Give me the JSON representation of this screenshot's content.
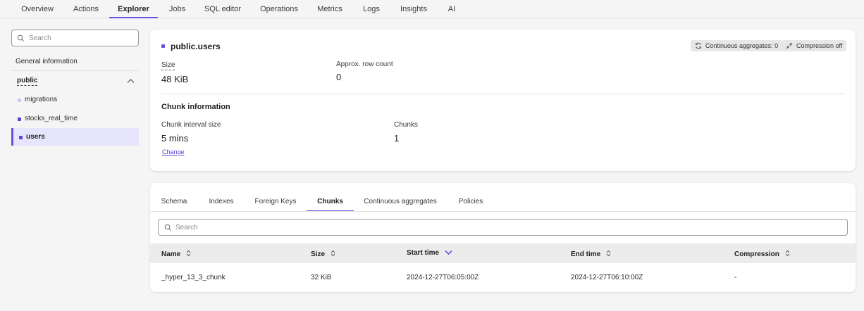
{
  "nav": {
    "tabs": [
      "Overview",
      "Actions",
      "Explorer",
      "Jobs",
      "SQL editor",
      "Operations",
      "Metrics",
      "Logs",
      "Insights",
      "AI"
    ],
    "active": "Explorer"
  },
  "sidebar": {
    "search_placeholder": "Search",
    "general_info": "General information",
    "schema": "public",
    "items": [
      {
        "label": "migrations",
        "color": "#c6c9f2"
      },
      {
        "label": "stocks_real_time",
        "color": "#5b3fd6"
      },
      {
        "label": "users",
        "color": "#5b3fd6"
      }
    ],
    "active_item": "users"
  },
  "info": {
    "table_name": "public.users",
    "badges": {
      "continuous_aggregates": "Continuous aggregates: 0",
      "compression": "Compression off"
    },
    "size_label": "Size",
    "size_value": "48 KiB",
    "row_count_label": "Approx. row count",
    "row_count_value": "0",
    "chunk_section_title": "Chunk information",
    "chunk_interval_label": "Chunk interval size",
    "chunk_interval_value": "5 mins",
    "chunks_label": "Chunks",
    "chunks_value": "1",
    "change_link": "Change"
  },
  "table_tabs": {
    "tabs": [
      "Schema",
      "Indexes",
      "Foreign Keys",
      "Chunks",
      "Continuous aggregates",
      "Policies"
    ],
    "active": "Chunks"
  },
  "chunks_table": {
    "search_placeholder": "Search",
    "columns": [
      "Name",
      "Size",
      "Start time",
      "End time",
      "Compression"
    ],
    "sorted_column": "Start time",
    "rows": [
      [
        "_hyper_13_3_chunk",
        "32 KiB",
        "2024-12-27T06:05:00Z",
        "2024-12-27T06:10:00Z",
        "-"
      ]
    ]
  },
  "colors": {
    "accent": "#6d4fe0",
    "active_bg": "#e6e5fb"
  }
}
